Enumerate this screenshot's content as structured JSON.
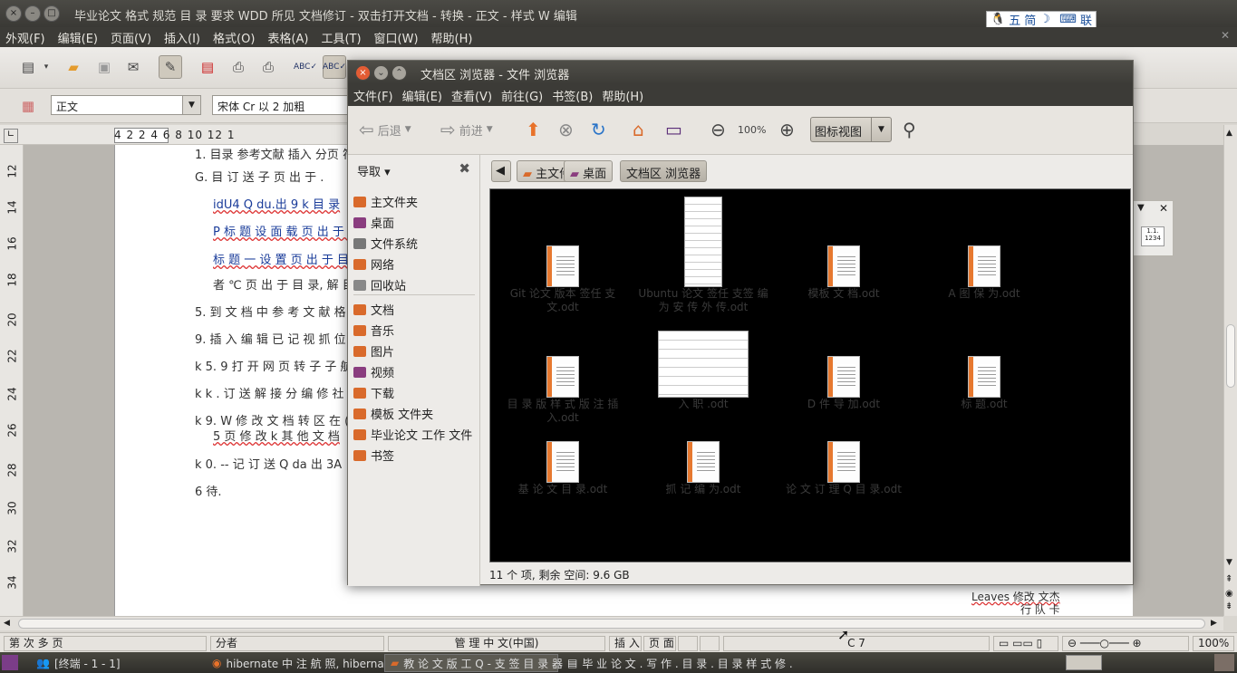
{
  "window": {
    "title": "毕业论文 格式 规范 目 录 要求 WDD 所见 文档修订 - 双击打开文档 - 转换 - 正文 - 样式 W 编辑",
    "menu": [
      "外观(F)",
      "编辑(E)",
      "页面(V)",
      "插入(I)",
      "格式(O)",
      "表格(A)",
      "工具(T)",
      "窗口(W)",
      "帮助(H)"
    ]
  },
  "ime": {
    "a": "五",
    "b": "简",
    "c": "联"
  },
  "toolbar2": {
    "style_value": "正文",
    "font_value": "宋体 Cr 以 2 加粗"
  },
  "ruler_h": "4   2        2    4    6    8    10    12   1",
  "ruler_v": [
    "12",
    "14",
    "16",
    "18",
    "20",
    "22",
    "24",
    "26",
    "28",
    "30",
    "32",
    "34"
  ],
  "doc": {
    "lines": [
      "1. 目录 参考文献 插入 分页 符号 格式",
      "G. 目 订 送 子 页 出 于 .",
      "idU4  Q du.出 9 k 目 录",
      "P 标 题  设 面 载 页 出 于 目 录",
      "标 题 一  设 置 页 出 于 目 录 。",
      "者 ℃ 页 出 于 目 录, 解 目 录",
      "5. 到 文 档 中 参 考 文 献 格 式",
      "9. 插 入 编 辑 已 记 视 抓 位 分 记",
      "k 5. 9 打 开 网 页 转 子 子 航 头",
      "k k . 订 送 解 接 分 编 修 社 正",
      "k 9. W 修 改 文 档 转 区 在 (5, 道)",
      "5 页 修 改 k   其 他 文 档",
      "k 0. -- 记 订 送  Q da 出 3A",
      "6 待."
    ],
    "foot_l1": "Leaves  修改  文杰",
    "foot_l2": "行 队 卡"
  },
  "status": {
    "page": "第 次 多 页",
    "style": "分者",
    "lang": "管 理 中 文(中国)",
    "insert": "插 入",
    "sel": "页 面",
    "sig": "",
    "info": "C 7",
    "zoom": "100%"
  },
  "taskbar": {
    "t1": "[终端 - 1 - 1]",
    "t2": "hibernate 中 注 航 照, hibernate -",
    "t3": "教 论 文 版 工 Q - 支 签 目 录 器",
    "t4": "毕 业 论 文 . 写 作 . 目 录 . 目 录 样 式 修 ."
  },
  "fm": {
    "title": "文档区 浏览器 - 文件 浏览器",
    "menu": [
      "文件(F)",
      "编辑(E)",
      "查看(V)",
      "前往(G)",
      "书签(B)",
      "帮助(H)"
    ],
    "tool": {
      "back": "后退",
      "forward": "前进",
      "zoom_label": "100%",
      "view_mode": "图标视图"
    },
    "side_header": "导取",
    "places": [
      {
        "label": "主文件夹",
        "color": "#d96a2b"
      },
      {
        "label": "桌面",
        "color": "#8a3d7f"
      },
      {
        "label": "文件系统",
        "color": "#777"
      },
      {
        "label": "网络",
        "color": "#d96a2b"
      },
      {
        "label": "回收站",
        "color": "#888"
      },
      {
        "label": "文档",
        "color": "#d96a2b"
      },
      {
        "label": "音乐",
        "color": "#d96a2b"
      },
      {
        "label": "图片",
        "color": "#d96a2b"
      },
      {
        "label": "视频",
        "color": "#8a3d7f"
      },
      {
        "label": "下载",
        "color": "#d96a2b"
      },
      {
        "label": "模板 文件夹",
        "color": "#d96a2b"
      },
      {
        "label": "毕业论文 工作 文件",
        "color": "#d96a2b"
      },
      {
        "label": "书签",
        "color": "#d96a2b"
      }
    ],
    "crumbs": [
      "主文件夹",
      "桌面",
      "文档区 浏览器"
    ],
    "files": [
      {
        "name": "Git 论文 版本 签任 支文.odt",
        "kind": "doc"
      },
      {
        "name": "Ubuntu 论文 签任 支签 编 为 安 传 外 传.odt",
        "kind": "tall"
      },
      {
        "name": "模板 文 档.odt",
        "kind": "doc"
      },
      {
        "name": "A 图 保 为.odt",
        "kind": "doc"
      },
      {
        "name": "目 录 版 样 式 版 注 插 入.odt",
        "kind": "doc"
      },
      {
        "name": "入 职 .odt",
        "kind": "wide"
      },
      {
        "name": "D 件 导 加.odt",
        "kind": "doc"
      },
      {
        "name": "标 题.odt",
        "kind": "doc"
      },
      {
        "name": "基 论 文 目 录.odt",
        "kind": "doc"
      },
      {
        "name": "抓 记 编 为.odt",
        "kind": "doc"
      },
      {
        "name": "论 文 订 理 Q 目 录.odt",
        "kind": "doc"
      }
    ],
    "status": "11 个 项, 剩余 空间: 9.6 GB"
  }
}
